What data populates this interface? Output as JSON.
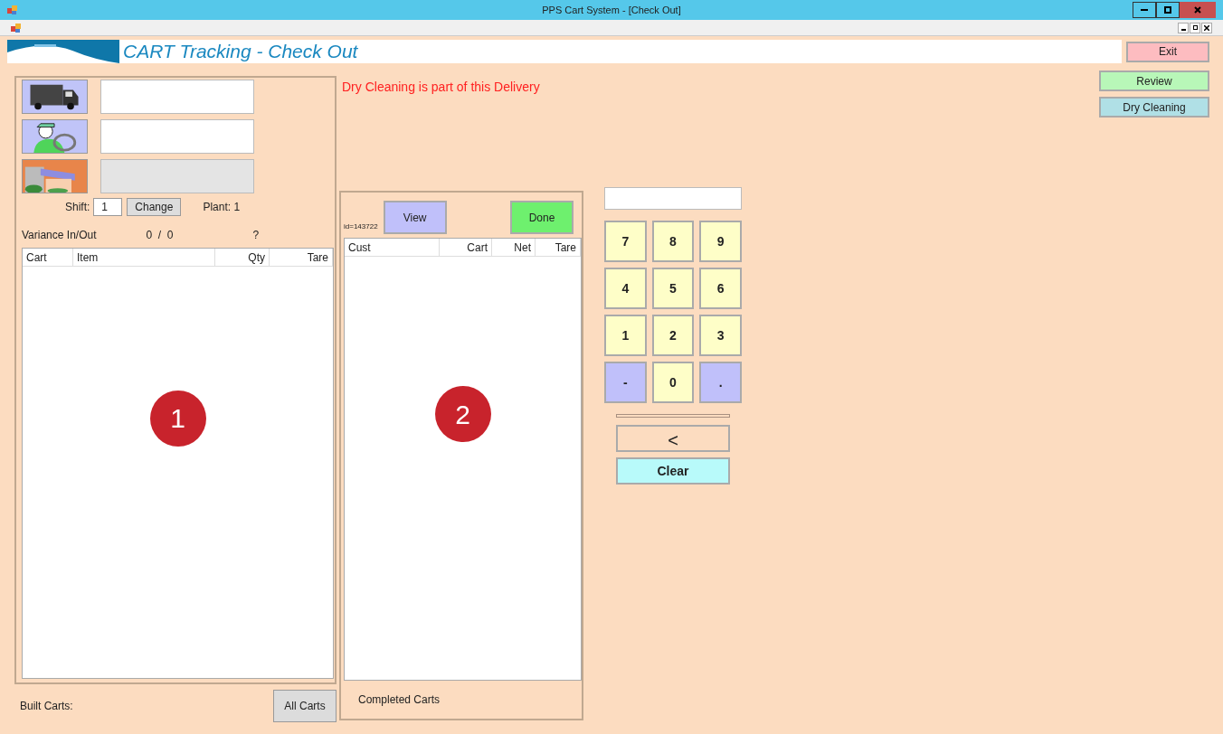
{
  "window": {
    "title": "PPS Cart System - [Check Out]"
  },
  "header": {
    "title": "CART Tracking - Check Out",
    "exit": "Exit"
  },
  "side_buttons": [
    {
      "label": "Review",
      "kind": "review"
    },
    {
      "label": "Dry Cleaning",
      "kind": "dry"
    }
  ],
  "entry_panel": {
    "rows": [
      {
        "kind": "truck",
        "value": "",
        "disabled": false
      },
      {
        "kind": "driver",
        "value": "",
        "disabled": false
      },
      {
        "kind": "store",
        "value": "",
        "disabled": true
      }
    ],
    "shift_label": "Shift:",
    "shift": "1",
    "change": "Change",
    "plant": "Plant: 1",
    "variance_label": "Variance In/Out",
    "variance": "0  /  0",
    "variance_flag": "?"
  },
  "built_table": {
    "columns": [
      "Cart",
      "Item",
      "Qty",
      "Tare"
    ],
    "marker": "1"
  },
  "built_carts": {
    "label": "Built Carts:",
    "button": "All Carts"
  },
  "notice": "Dry Cleaning is part of this Delivery",
  "completed_panel": {
    "id": "id=143722",
    "view": "View",
    "done": "Done",
    "columns": [
      "Cust",
      "Cart",
      "Net",
      "Tare"
    ],
    "marker": "2",
    "footer": "Completed Carts"
  },
  "keypad": {
    "keys": [
      {
        "label": "7",
        "kind": "digit"
      },
      {
        "label": "8",
        "kind": "digit"
      },
      {
        "label": "9",
        "kind": "digit"
      },
      {
        "label": "4",
        "kind": "digit"
      },
      {
        "label": "5",
        "kind": "digit"
      },
      {
        "label": "6",
        "kind": "digit"
      },
      {
        "label": "1",
        "kind": "digit"
      },
      {
        "label": "2",
        "kind": "digit"
      },
      {
        "label": "3",
        "kind": "digit"
      },
      {
        "label": "-",
        "kind": "symbol"
      },
      {
        "label": "0",
        "kind": "digit"
      },
      {
        "label": ".",
        "kind": "symbol"
      }
    ],
    "back": "<",
    "clear": "Clear"
  }
}
